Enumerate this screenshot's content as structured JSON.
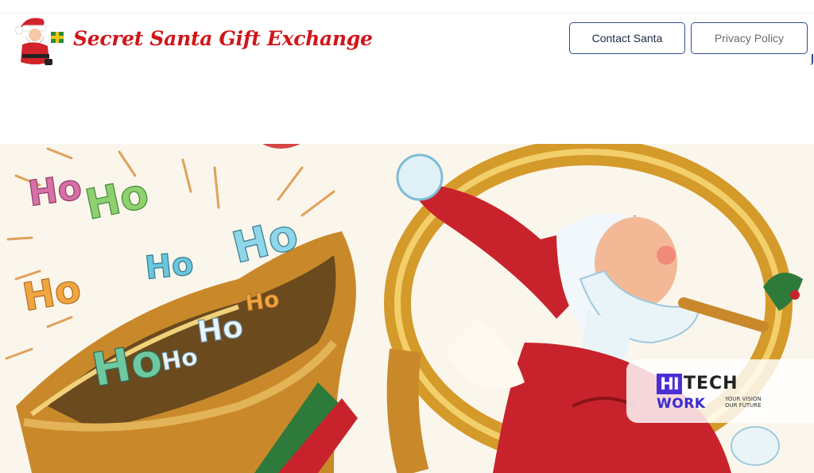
{
  "header": {
    "site_title": "Secret Santa Gift Exchange",
    "buttons": {
      "contact": "Contact Santa",
      "privacy": "Privacy Policy"
    }
  },
  "hero": {
    "shout_words": [
      "Ho",
      "Ho",
      "Ho",
      "Ho",
      "Ho",
      "Ho",
      "Ho",
      "Ho",
      "Ho"
    ]
  },
  "watermark": {
    "hi": "HI",
    "tech": "TECH",
    "work": "WORK",
    "tagline_1": "YOUR VISION",
    "tagline_2": "OUR FUTURE"
  },
  "colors": {
    "title_red": "#d0161a",
    "button_border": "#2c4f8f",
    "horn_gold": "#d49a2a",
    "santa_red": "#c8232c",
    "watermark_purple": "#4a2fd6"
  }
}
